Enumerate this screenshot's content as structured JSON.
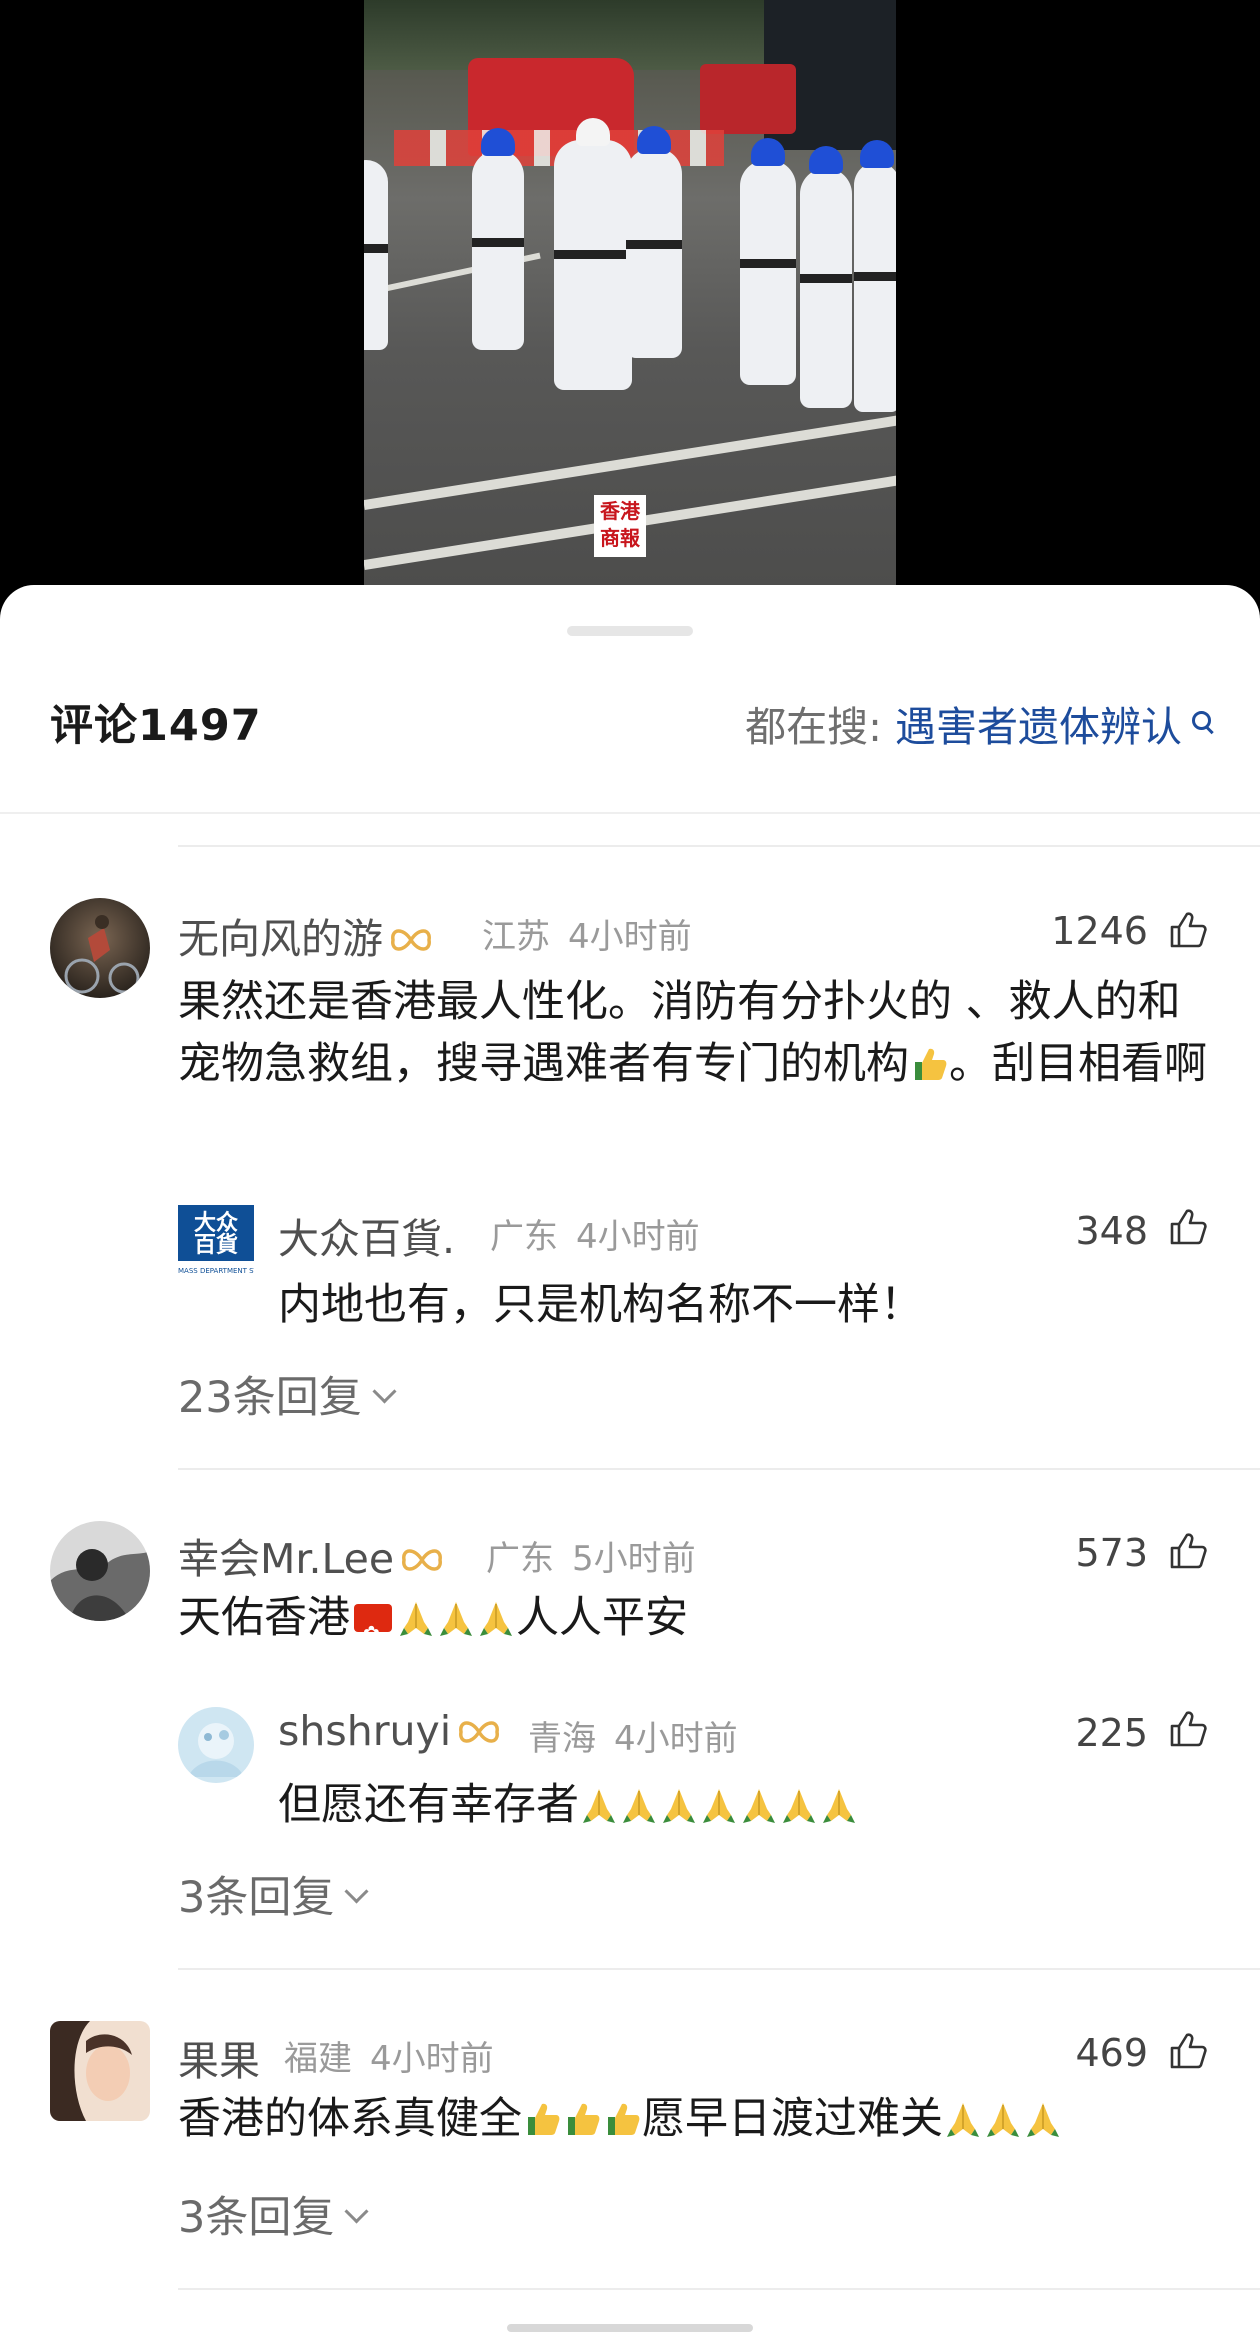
{
  "video": {
    "watermark": "香港商報"
  },
  "header": {
    "comment_count": "评论1497",
    "search_label": "都在搜: ",
    "search_keyword": "遇害者遗体辨认"
  },
  "comments": [
    {
      "username": "无向风的游",
      "location": "江苏",
      "time": "4小时前",
      "likes": "1246",
      "content_parts": [
        "果然还是香港最人性化。消防有分扑火的 、救人的和宠物急救组，搜寻遇难者有专门的机构",
        "。刮目相看啊"
      ],
      "content_emoji": "thumbs-up",
      "reply": {
        "username": "大众百貨.",
        "avatar_text": [
          "大众",
          "百貨"
        ],
        "avatar_sub": "MASS DEPARTMENT STORE",
        "location": "广东",
        "time": "4小时前",
        "likes": "348",
        "content": "内地也有，只是机构名称不一样！"
      },
      "replies_link": "23条回复"
    },
    {
      "username": "幸会Mr.Lee",
      "location": "广东",
      "time": "5小时前",
      "likes": "573",
      "content_prefix": "天佑香港",
      "content_suffix": "人人平安",
      "reply": {
        "username": "shshruyi",
        "location": "青海",
        "time": "4小时前",
        "likes": "225",
        "content": "但愿还有幸存者"
      },
      "replies_link": "3条回复"
    },
    {
      "username": "果果",
      "location": "福建",
      "time": "4小时前",
      "likes": "469",
      "content_prefix": "香港的体系真健全",
      "content_suffix": "愿早日渡过难关",
      "replies_link": "3条回复"
    }
  ],
  "colors": {
    "keyword_blue": "#1d4c9c",
    "vip_gold": "#e8b04a",
    "flag_red": "#de2910"
  },
  "icons": [
    "search-icon",
    "like-icon",
    "vip-badge-icon",
    "chevron-down-icon",
    "thumbs-up-emoji",
    "praying-hands-emoji",
    "hong-kong-flag-icon"
  ]
}
